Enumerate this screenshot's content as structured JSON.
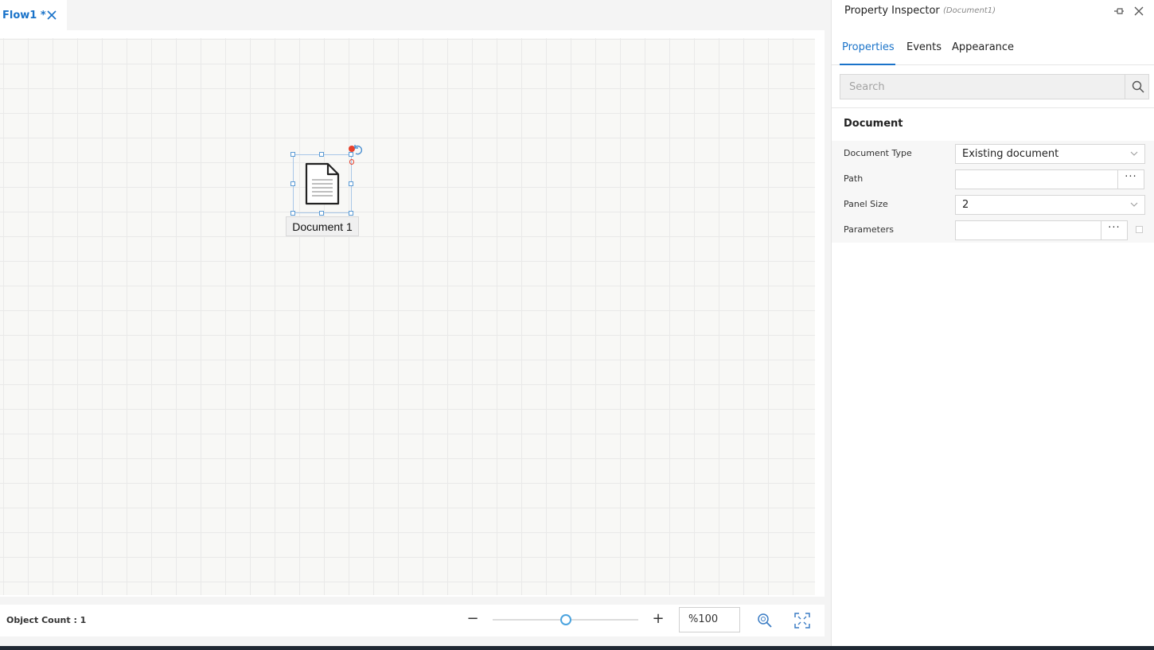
{
  "tab": {
    "label": "Flow1 *",
    "close_icon": "close-icon"
  },
  "canvas": {
    "node": {
      "label": "Document 1",
      "icon": "document-icon"
    }
  },
  "statusbar": {
    "object_count": "Object Count : 1",
    "zoom_minus": "−",
    "zoom_plus": "+",
    "zoom_value": "%100",
    "zoom_level_percent": 100
  },
  "inspector": {
    "title": "Property Inspector",
    "subtitle": "(Document1)",
    "tabs": [
      {
        "label": "Properties",
        "active": true
      },
      {
        "label": "Events",
        "active": false
      },
      {
        "label": "Appearance",
        "active": false
      }
    ],
    "search_placeholder": "Search",
    "section_title": "Document",
    "properties": [
      {
        "label": "Document Type",
        "value": "Existing document",
        "kind": "select"
      },
      {
        "label": "Path",
        "value": "",
        "kind": "text-ellipsis"
      },
      {
        "label": "Panel Size",
        "value": "2",
        "kind": "select"
      },
      {
        "label": "Parameters",
        "value": "",
        "kind": "text-ellipsis-check"
      }
    ],
    "ellipsis": "···"
  },
  "colors": {
    "accent": "#1a73c9",
    "handle": "#5b9bd5",
    "marker": "#e8412c"
  }
}
